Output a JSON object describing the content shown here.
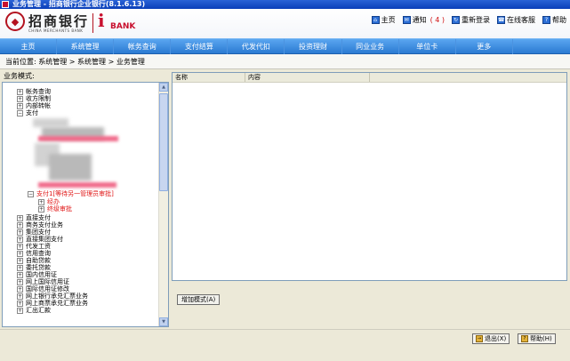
{
  "window": {
    "title": "业务管理 - 招商银行企业银行(8.1.6.13)"
  },
  "header": {
    "logo": {
      "cn": "招商银行",
      "en": "CHINA MERCHANTS BANK",
      "ubank_i": "i",
      "ubank_text": "BANK"
    },
    "links": [
      {
        "id": "home",
        "label": "主页",
        "icon": "home-icon"
      },
      {
        "id": "notice",
        "label": "通知",
        "count": "( 4 )",
        "icon": "notice-icon"
      },
      {
        "id": "relogin",
        "label": "重新登录",
        "icon": "relogin-icon"
      },
      {
        "id": "service",
        "label": "在线客服",
        "icon": "phone-icon"
      },
      {
        "id": "help",
        "label": "帮助",
        "icon": "help-icon"
      }
    ]
  },
  "nav": [
    {
      "id": "home",
      "label": "主页"
    },
    {
      "id": "system",
      "label": "系统管理"
    },
    {
      "id": "account",
      "label": "帐务查询"
    },
    {
      "id": "payment",
      "label": "支付结算"
    },
    {
      "id": "agency",
      "label": "代发代扣"
    },
    {
      "id": "invest",
      "label": "投资理财"
    },
    {
      "id": "interbank",
      "label": "同业业务"
    },
    {
      "id": "unit-card",
      "label": "单位卡"
    },
    {
      "id": "more",
      "label": "更多"
    }
  ],
  "breadcrumb": "当前位置: 系统管理 > 系统管理 > 业务管理",
  "left": {
    "label": "业务模式:",
    "tree_top": [
      {
        "label": "帐务查询",
        "toggle": "+"
      },
      {
        "label": "收方限制",
        "toggle": "+"
      },
      {
        "label": "内部转帐",
        "toggle": "+"
      },
      {
        "label": "支付",
        "toggle": "-"
      }
    ],
    "tree_highlight": {
      "label": "支付1[等待另一管理员审批]",
      "toggle": "-"
    },
    "tree_children": [
      {
        "label": "经办",
        "toggle": "+"
      },
      {
        "label": "终级审批",
        "toggle": "+"
      }
    ],
    "tree_bottom": [
      {
        "label": "直接支付",
        "toggle": "+"
      },
      {
        "label": "商务支付业务",
        "toggle": "+"
      },
      {
        "label": "集团支付",
        "toggle": "+"
      },
      {
        "label": "直接集团支付",
        "toggle": "+"
      },
      {
        "label": "代发工资",
        "toggle": "+"
      },
      {
        "label": "信用查询",
        "toggle": "+"
      },
      {
        "label": "自助贷款",
        "toggle": "+"
      },
      {
        "label": "委托贷款",
        "toggle": "+"
      },
      {
        "label": "国内信用证",
        "toggle": "+"
      },
      {
        "label": "网上国际信用证",
        "toggle": "+"
      },
      {
        "label": "国际信用证修改",
        "toggle": "+"
      },
      {
        "label": "网上银行承兑汇票业务",
        "toggle": "+"
      },
      {
        "label": "网上商票承兑汇票业务",
        "toggle": "+"
      },
      {
        "label": "汇出汇款",
        "toggle": "+"
      }
    ]
  },
  "right": {
    "columns": [
      {
        "label": "名称"
      },
      {
        "label": "内容"
      }
    ],
    "add_mode_label": "增加模式(A)"
  },
  "bottom": {
    "exit_label": "退出(X)",
    "help_label": "帮助(H)"
  },
  "colors": {
    "nav_bg": "#3a8ae0",
    "highlight_red": "#e01616",
    "brand_red": "#c8102e"
  }
}
